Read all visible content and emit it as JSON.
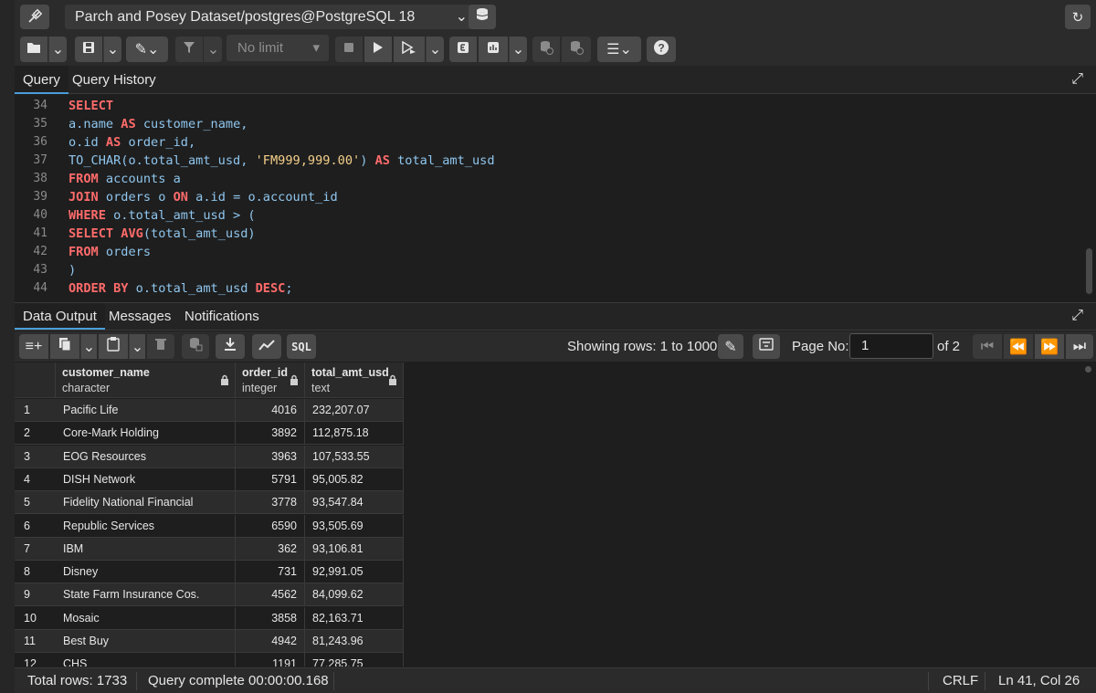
{
  "connection": {
    "label": "Parch and Posey Dataset/postgres@PostgreSQL 18"
  },
  "toolbar": {
    "limit_value": "No limit"
  },
  "editor_tabs": [
    "Query",
    "Query History"
  ],
  "editor": {
    "lines": [
      {
        "num": "34"
      },
      {
        "num": "35"
      },
      {
        "num": "36"
      },
      {
        "num": "37"
      },
      {
        "num": "38"
      },
      {
        "num": "39"
      },
      {
        "num": "40"
      },
      {
        "num": "41"
      },
      {
        "num": "42"
      },
      {
        "num": "43"
      },
      {
        "num": "44"
      }
    ],
    "tokens": {
      "l34_kw": "SELECT",
      "l35_a": "a.name ",
      "l35_kw": "AS",
      "l35_b": " customer_name,",
      "l36_a": "o.id ",
      "l36_kw": "AS",
      "l36_b": " order_id,",
      "l37_a": "TO_CHAR(o.total_amt_usd, ",
      "l37_str": "'FM999,999.00'",
      "l37_b": ") ",
      "l37_kw": "AS",
      "l37_c": " total_amt_usd",
      "l38_kw": "FROM",
      "l38_a": " accounts a",
      "l39_kw1": "JOIN",
      "l39_a": " orders o ",
      "l39_kw2": "ON",
      "l39_b": " a.id = o.account_id",
      "l40_kw": "WHERE",
      "l40_a": " o.total_amt_usd > (",
      "l41_kw1": "SELECT",
      "l41_kw2": " AVG",
      "l41_a": "(total_amt_usd)",
      "l42_kw": "FROM",
      "l42_a": " orders",
      "l43_a": ")",
      "l44_kw1": "ORDER BY",
      "l44_a": " o.total_amt_usd ",
      "l44_kw2": "DESC",
      "l44_b": ";"
    }
  },
  "output_tabs": [
    "Data Output",
    "Messages",
    "Notifications"
  ],
  "output_toolbar": {
    "sql_label": "SQL",
    "showing": "Showing rows: 1 to 1000",
    "page_label": "Page No:",
    "page_value": "1",
    "of_pages": "of 2"
  },
  "grid": {
    "columns": [
      {
        "name": "customer_name",
        "type": "character"
      },
      {
        "name": "order_id",
        "type": "integer"
      },
      {
        "name": "total_amt_usd",
        "type": "text"
      }
    ],
    "rows": [
      [
        "1",
        "Pacific Life",
        "4016",
        "232,207.07"
      ],
      [
        "2",
        "Core-Mark Holding",
        "3892",
        "112,875.18"
      ],
      [
        "3",
        "EOG Resources",
        "3963",
        "107,533.55"
      ],
      [
        "4",
        "DISH Network",
        "5791",
        "95,005.82"
      ],
      [
        "5",
        "Fidelity National Financial",
        "3778",
        "93,547.84"
      ],
      [
        "6",
        "Republic Services",
        "6590",
        "93,505.69"
      ],
      [
        "7",
        "IBM",
        "362",
        "93,106.81"
      ],
      [
        "8",
        "Disney",
        "731",
        "92,991.05"
      ],
      [
        "9",
        "State Farm Insurance Cos.",
        "4562",
        "84,099.62"
      ],
      [
        "10",
        "Mosaic",
        "3858",
        "82,163.71"
      ],
      [
        "11",
        "Best Buy",
        "4942",
        "81,243.96"
      ],
      [
        "12",
        "CHS",
        "1191",
        "77,285.75"
      ]
    ]
  },
  "status": {
    "total_rows": "Total rows: 1733",
    "query_complete": "Query complete 00:00:00.168",
    "line_ending": "CRLF",
    "cursor": "Ln 41, Col 26"
  },
  "colors": {
    "keyword": "#ff6b6b",
    "identifier": "#8fc6ee",
    "string": "#f5d08a",
    "accent": "#4a9eda"
  }
}
